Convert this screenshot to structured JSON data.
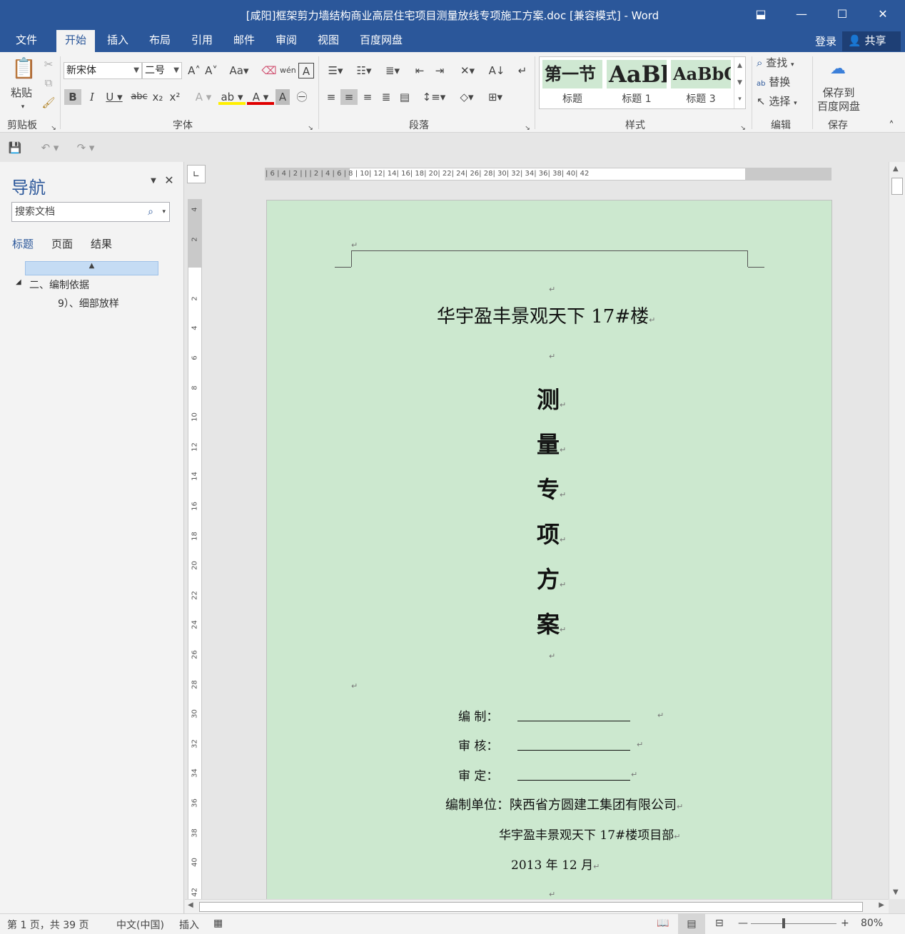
{
  "window": {
    "title": "[咸阳]框架剪力墙结构商业高层住宅项目测量放线专项施工方案.doc [兼容模式] - Word"
  },
  "tabs": [
    "文件",
    "开始",
    "插入",
    "布局",
    "引用",
    "邮件",
    "审阅",
    "视图",
    "百度网盘"
  ],
  "account": {
    "login": "登录",
    "share": "共享"
  },
  "ribbon": {
    "clipboard": {
      "paste": "粘贴",
      "label": "剪贴板"
    },
    "font": {
      "name": "新宋体",
      "size": "二号",
      "label": "字体"
    },
    "paragraph": {
      "label": "段落"
    },
    "styles": {
      "label": "样式",
      "items": [
        {
          "preview": "第一节",
          "name": "标题"
        },
        {
          "preview": "AaBl",
          "name": "标题 1"
        },
        {
          "preview": "AaBbC",
          "name": "标题 3"
        }
      ]
    },
    "editing": {
      "find": "查找",
      "replace": "替换",
      "select": "选择",
      "label": "编辑"
    },
    "save": {
      "line1": "保存到",
      "line2": "百度网盘",
      "label": "保存"
    }
  },
  "nav": {
    "title": "导航",
    "search_placeholder": "搜索文档",
    "tabs": [
      "标题",
      "页面",
      "结果"
    ],
    "items": [
      "二、编制依据",
      "9）、细部放样"
    ]
  },
  "document": {
    "project": "华宇盈丰景观天下 17#楼",
    "title_chars": [
      "测",
      "量",
      "专",
      "项",
      "方",
      "案"
    ],
    "sign": [
      {
        "label": "编  制："
      },
      {
        "label": "审  核："
      },
      {
        "label": "审  定："
      }
    ],
    "unit": "编制单位：陕西省方圆建工集团有限公司",
    "dept": "华宇盈丰景观天下 17#楼项目部",
    "date": "2013 年 12 月"
  },
  "ruler": {
    "h_labels": "| 6 |  4 |  2 |  |  | 2 |  4 |  6 |  8 | 10| 12| 14| 16| 18| 20| 22| 24| 26| 28| 30| 32| 34| 36| 38| 40| 42",
    "v_labels": [
      "4",
      "2",
      "",
      "2",
      "4",
      "6",
      "8",
      "10",
      "12",
      "14",
      "16",
      "18",
      "20",
      "22",
      "24",
      "26",
      "28",
      "30",
      "32",
      "34",
      "36",
      "38",
      "40",
      "42"
    ]
  },
  "status": {
    "page": "第 1 页，共 39 页",
    "language": "中文(中国)",
    "mode": "插入",
    "zoom": "80%"
  },
  "colors": {
    "brand": "#2b579a",
    "page": "#cce8cf"
  }
}
